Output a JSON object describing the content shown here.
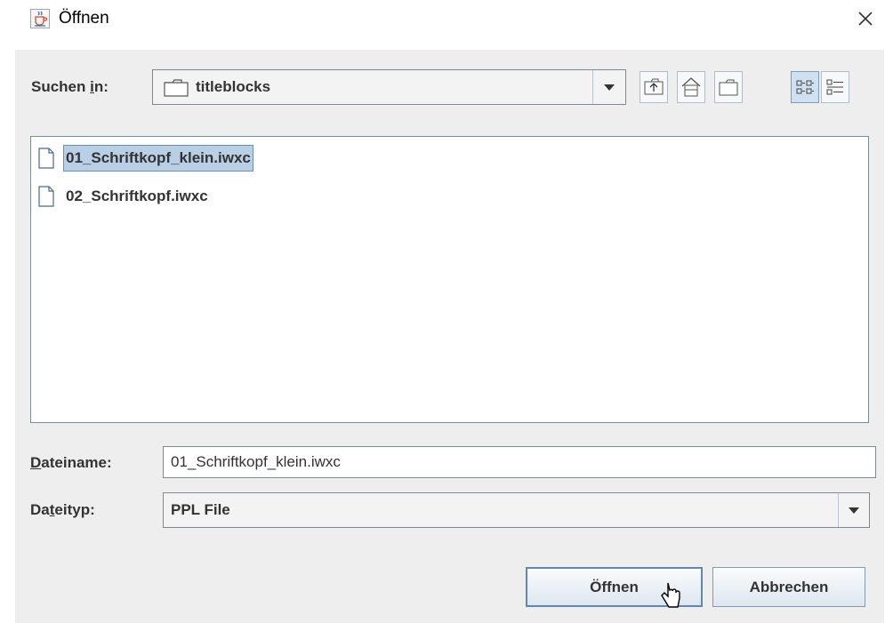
{
  "window": {
    "title": "Öffnen",
    "app_icon": "java-cup-icon",
    "close_icon": "close-icon"
  },
  "look_in": {
    "label_pre": "Suchen ",
    "label_mnemonic": "i",
    "label_post": "n:",
    "value": "titleblocks",
    "folder_icon": "folder-icon"
  },
  "toolbar": {
    "buttons": [
      {
        "name": "up-one-level-icon"
      },
      {
        "name": "home-icon"
      },
      {
        "name": "new-folder-icon"
      },
      {
        "name": "list-view-icon",
        "active": true
      },
      {
        "name": "details-view-icon"
      }
    ]
  },
  "files": [
    {
      "name": "01_Schriftkopf_klein.iwxc",
      "selected": true
    },
    {
      "name": "02_Schriftkopf.iwxc",
      "selected": false
    }
  ],
  "filename": {
    "label_mnemonic": "D",
    "label_post": "ateiname:",
    "value": "01_Schriftkopf_klein.iwxc"
  },
  "filetype": {
    "label_pre": "Da",
    "label_mnemonic": "t",
    "label_post": "eityp:",
    "value": "PPL File"
  },
  "buttons": {
    "open": "Öffnen",
    "cancel": "Abbrechen"
  },
  "colors": {
    "selection": "#b8cfe5",
    "dialog_bg": "#eeeeee",
    "text": "#333333"
  }
}
